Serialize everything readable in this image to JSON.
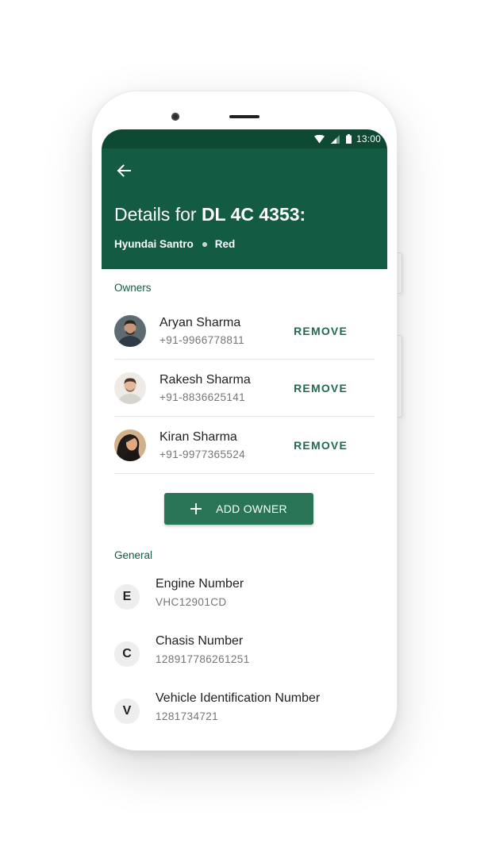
{
  "status_bar": {
    "time": "13:00",
    "icons": [
      "wifi-icon",
      "signal-icon",
      "battery-icon"
    ]
  },
  "header": {
    "title_prefix": "Details for ",
    "plate": "DL 4C 4353:",
    "model": "Hyundai Santro",
    "color": "Red",
    "back_icon": "arrow-back-icon"
  },
  "owners_section": {
    "label": "Owners",
    "remove_label": "REMOVE",
    "owners": [
      {
        "name": "Aryan Sharma",
        "phone": "+91-9966778811"
      },
      {
        "name": "Rakesh Sharma",
        "phone": "+91-8836625141"
      },
      {
        "name": "Kiran Sharma",
        "phone": "+91-9977365524"
      }
    ],
    "add_owner_label": "ADD OWNER"
  },
  "general_section": {
    "label": "General",
    "items": [
      {
        "letter": "E",
        "title": "Engine Number",
        "value": "VHC12901CD"
      },
      {
        "letter": "C",
        "title": "Chasis Number",
        "value": "128917786261251"
      },
      {
        "letter": "V",
        "title": "Vehicle Identification Number",
        "value": "1281734721"
      }
    ]
  },
  "colors": {
    "status_bar": "#0e4a33",
    "app_bar": "#135c43",
    "accent": "#1f6b4c",
    "button": "#2b7557"
  }
}
